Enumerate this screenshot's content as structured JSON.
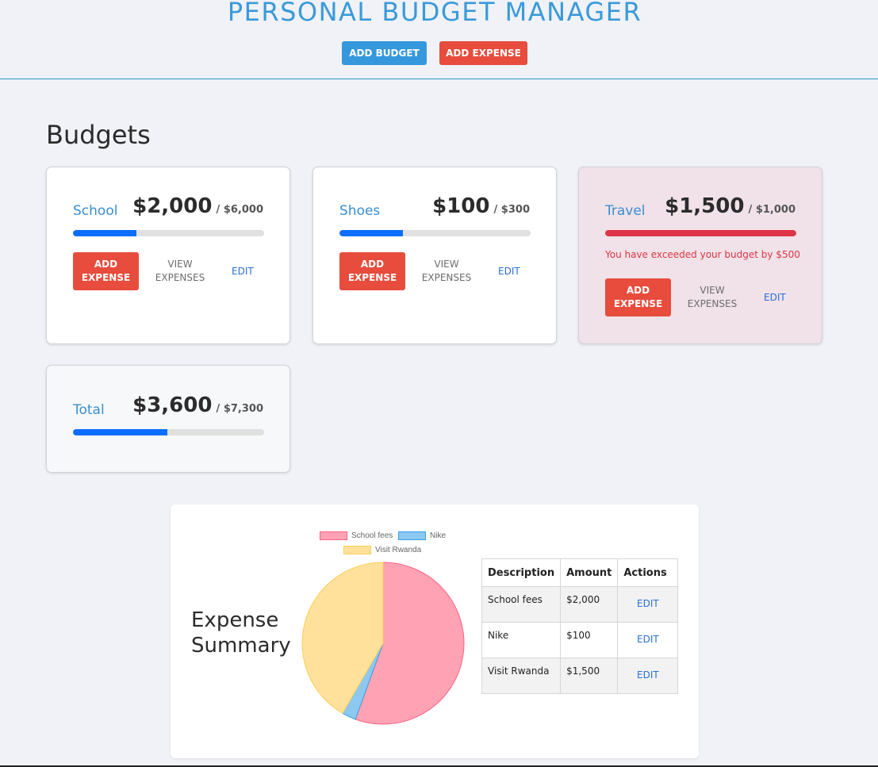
{
  "header": {
    "title": "PERSONAL BUDGET MANAGER",
    "add_budget_label": "ADD BUDGET",
    "add_expense_label": "ADD EXPENSE"
  },
  "budgets_section": {
    "title": "Budgets"
  },
  "budgets": [
    {
      "name": "School",
      "spent": "$2,000",
      "max": "/ $6,000",
      "progress": 0.333,
      "add_expense_label": "ADD EXPENSE",
      "view_label": "VIEW EXPENSES",
      "edit_label": "EDIT",
      "warning": ""
    },
    {
      "name": "Shoes",
      "spent": "$100",
      "max": "/ $300",
      "progress": 0.333,
      "add_expense_label": "ADD EXPENSE",
      "view_label": "VIEW EXPENSES",
      "edit_label": "EDIT",
      "warning": ""
    },
    {
      "name": "Travel",
      "spent": "$1,500",
      "max": "/ $1,000",
      "progress": 1.0,
      "add_expense_label": "ADD EXPENSE",
      "view_label": "VIEW EXPENSES",
      "edit_label": "EDIT",
      "warning": "You have exceeded your budget by $500"
    }
  ],
  "total": {
    "name": "Total",
    "spent": "$3,600",
    "max": "/ $7,300",
    "progress": 0.493
  },
  "summary": {
    "title": "Expense Summary",
    "table": {
      "headers": [
        "Description",
        "Amount",
        "Actions"
      ],
      "rows": [
        {
          "description": "School fees",
          "amount": "$2,000",
          "action": "EDIT"
        },
        {
          "description": "Nike",
          "amount": "$100",
          "action": "EDIT"
        },
        {
          "description": "Visit Rwanda",
          "amount": "$1,500",
          "action": "EDIT"
        }
      ]
    }
  },
  "chart_data": {
    "type": "pie",
    "categories": [
      "School fees",
      "Nike",
      "Visit Rwanda"
    ],
    "values": [
      2000,
      100,
      1500
    ],
    "colors": [
      "#ffa2b4",
      "#8cc8f0",
      "#ffe19c"
    ],
    "borders": [
      "#ff6384",
      "#36a2eb",
      "#ffcd56"
    ],
    "legend": "top"
  }
}
